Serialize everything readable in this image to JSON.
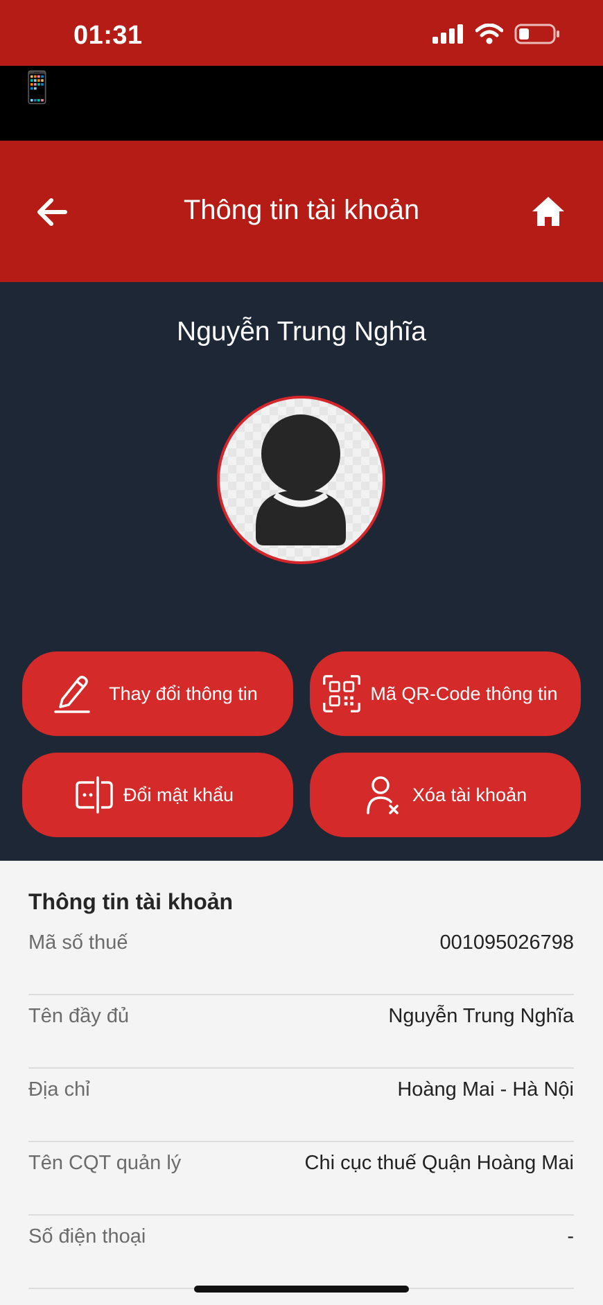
{
  "status_bar": {
    "time": "01:31"
  },
  "top_strip": {
    "emoji": "📱"
  },
  "header": {
    "title": "Thông tin tài khoản"
  },
  "profile": {
    "name": "Nguyễn Trung Nghĩa"
  },
  "actions": {
    "edit_label": "Thay đổi thông tin",
    "qr_label": "Mã QR-Code thông tin",
    "password_label": "Đổi mật khẩu",
    "delete_label": "Xóa tài khoản"
  },
  "info": {
    "title": "Thông tin tài khoản",
    "rows": [
      {
        "label": "Mã số thuế",
        "value": "001095026798"
      },
      {
        "label": "Tên đầy đủ",
        "value": "Nguyễn Trung Nghĩa"
      },
      {
        "label": "Địa chỉ",
        "value": "Hoàng Mai - Hà Nội"
      },
      {
        "label": "Tên CQT quản lý",
        "value": "Chi cục thuế Quận Hoàng Mai"
      },
      {
        "label": "Số điện thoại",
        "value": "-"
      }
    ]
  },
  "colors": {
    "primary_red": "#b51c16",
    "button_red": "#d42a2a",
    "dark_navy": "#1d2735"
  }
}
